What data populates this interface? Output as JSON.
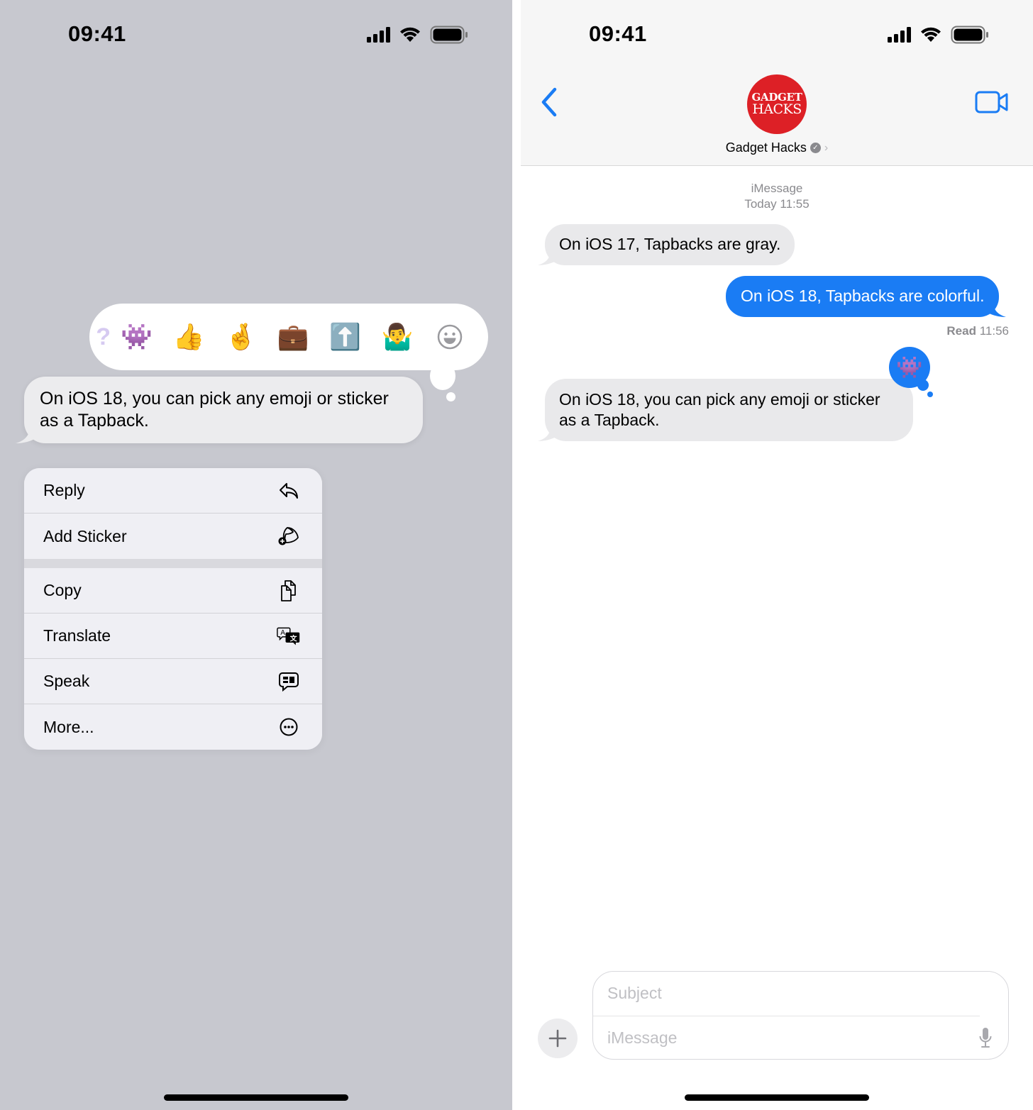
{
  "left": {
    "status_bar": {
      "time": "09:41",
      "icons": [
        "signal-icon",
        "wifi-icon",
        "battery-icon"
      ]
    },
    "tapback_bar": {
      "items": [
        {
          "name": "question-mark",
          "glyph": "?"
        },
        {
          "name": "monster-sticker",
          "glyph": "👾"
        },
        {
          "name": "thumbs-up",
          "glyph": "👍"
        },
        {
          "name": "crossed-fingers",
          "glyph": "🤞"
        },
        {
          "name": "briefcase",
          "glyph": "💼"
        },
        {
          "name": "up-arrow",
          "glyph": "⬆️"
        },
        {
          "name": "person-shrugging",
          "glyph": "🤷‍♂️"
        },
        {
          "name": "add-emoji",
          "glyph": "☺"
        }
      ]
    },
    "focused_message": {
      "text": "On iOS 18, you can pick any emoji or sticker as a Tapback."
    },
    "context_menu": {
      "items": [
        {
          "label": "Reply",
          "icon": "reply-icon"
        },
        {
          "label": "Add Sticker",
          "icon": "add-sticker-icon"
        },
        {
          "label": "Copy",
          "icon": "copy-icon"
        },
        {
          "label": "Translate",
          "icon": "translate-icon"
        },
        {
          "label": "Speak",
          "icon": "speak-icon"
        },
        {
          "label": "More...",
          "icon": "more-icon"
        }
      ]
    }
  },
  "right": {
    "status_bar": {
      "time": "09:41",
      "icons": [
        "signal-icon",
        "wifi-icon",
        "battery-icon"
      ]
    },
    "header": {
      "avatar_line1": "GADGET",
      "avatar_line2": "HACKS",
      "contact_name": "Gadget Hacks",
      "verified_glyph": "✓",
      "chevron": "›",
      "avatar_color": "#dd2026"
    },
    "conversation": {
      "service_label": "iMessage",
      "timestamp": "Today 11:55",
      "messages": [
        {
          "direction": "incoming",
          "text": "On iOS 17, Tapbacks are gray."
        },
        {
          "direction": "outgoing",
          "text": "On iOS 18, Tapbacks are colorful."
        },
        {
          "direction": "incoming",
          "text": "On iOS 18, you can pick any emoji or sticker as a Tapback.",
          "tapback": "👾"
        }
      ],
      "read_receipt_label": "Read",
      "read_receipt_time": "11:56"
    },
    "composer": {
      "subject_placeholder": "Subject",
      "message_placeholder": "iMessage",
      "subject_value": "",
      "message_value": ""
    }
  },
  "colors": {
    "accent_blue": "#1a7cf4",
    "incoming_bubble": "#e9e9eb",
    "dimmed_background": "#c7c8cf",
    "menu_background": "#efeff4"
  }
}
